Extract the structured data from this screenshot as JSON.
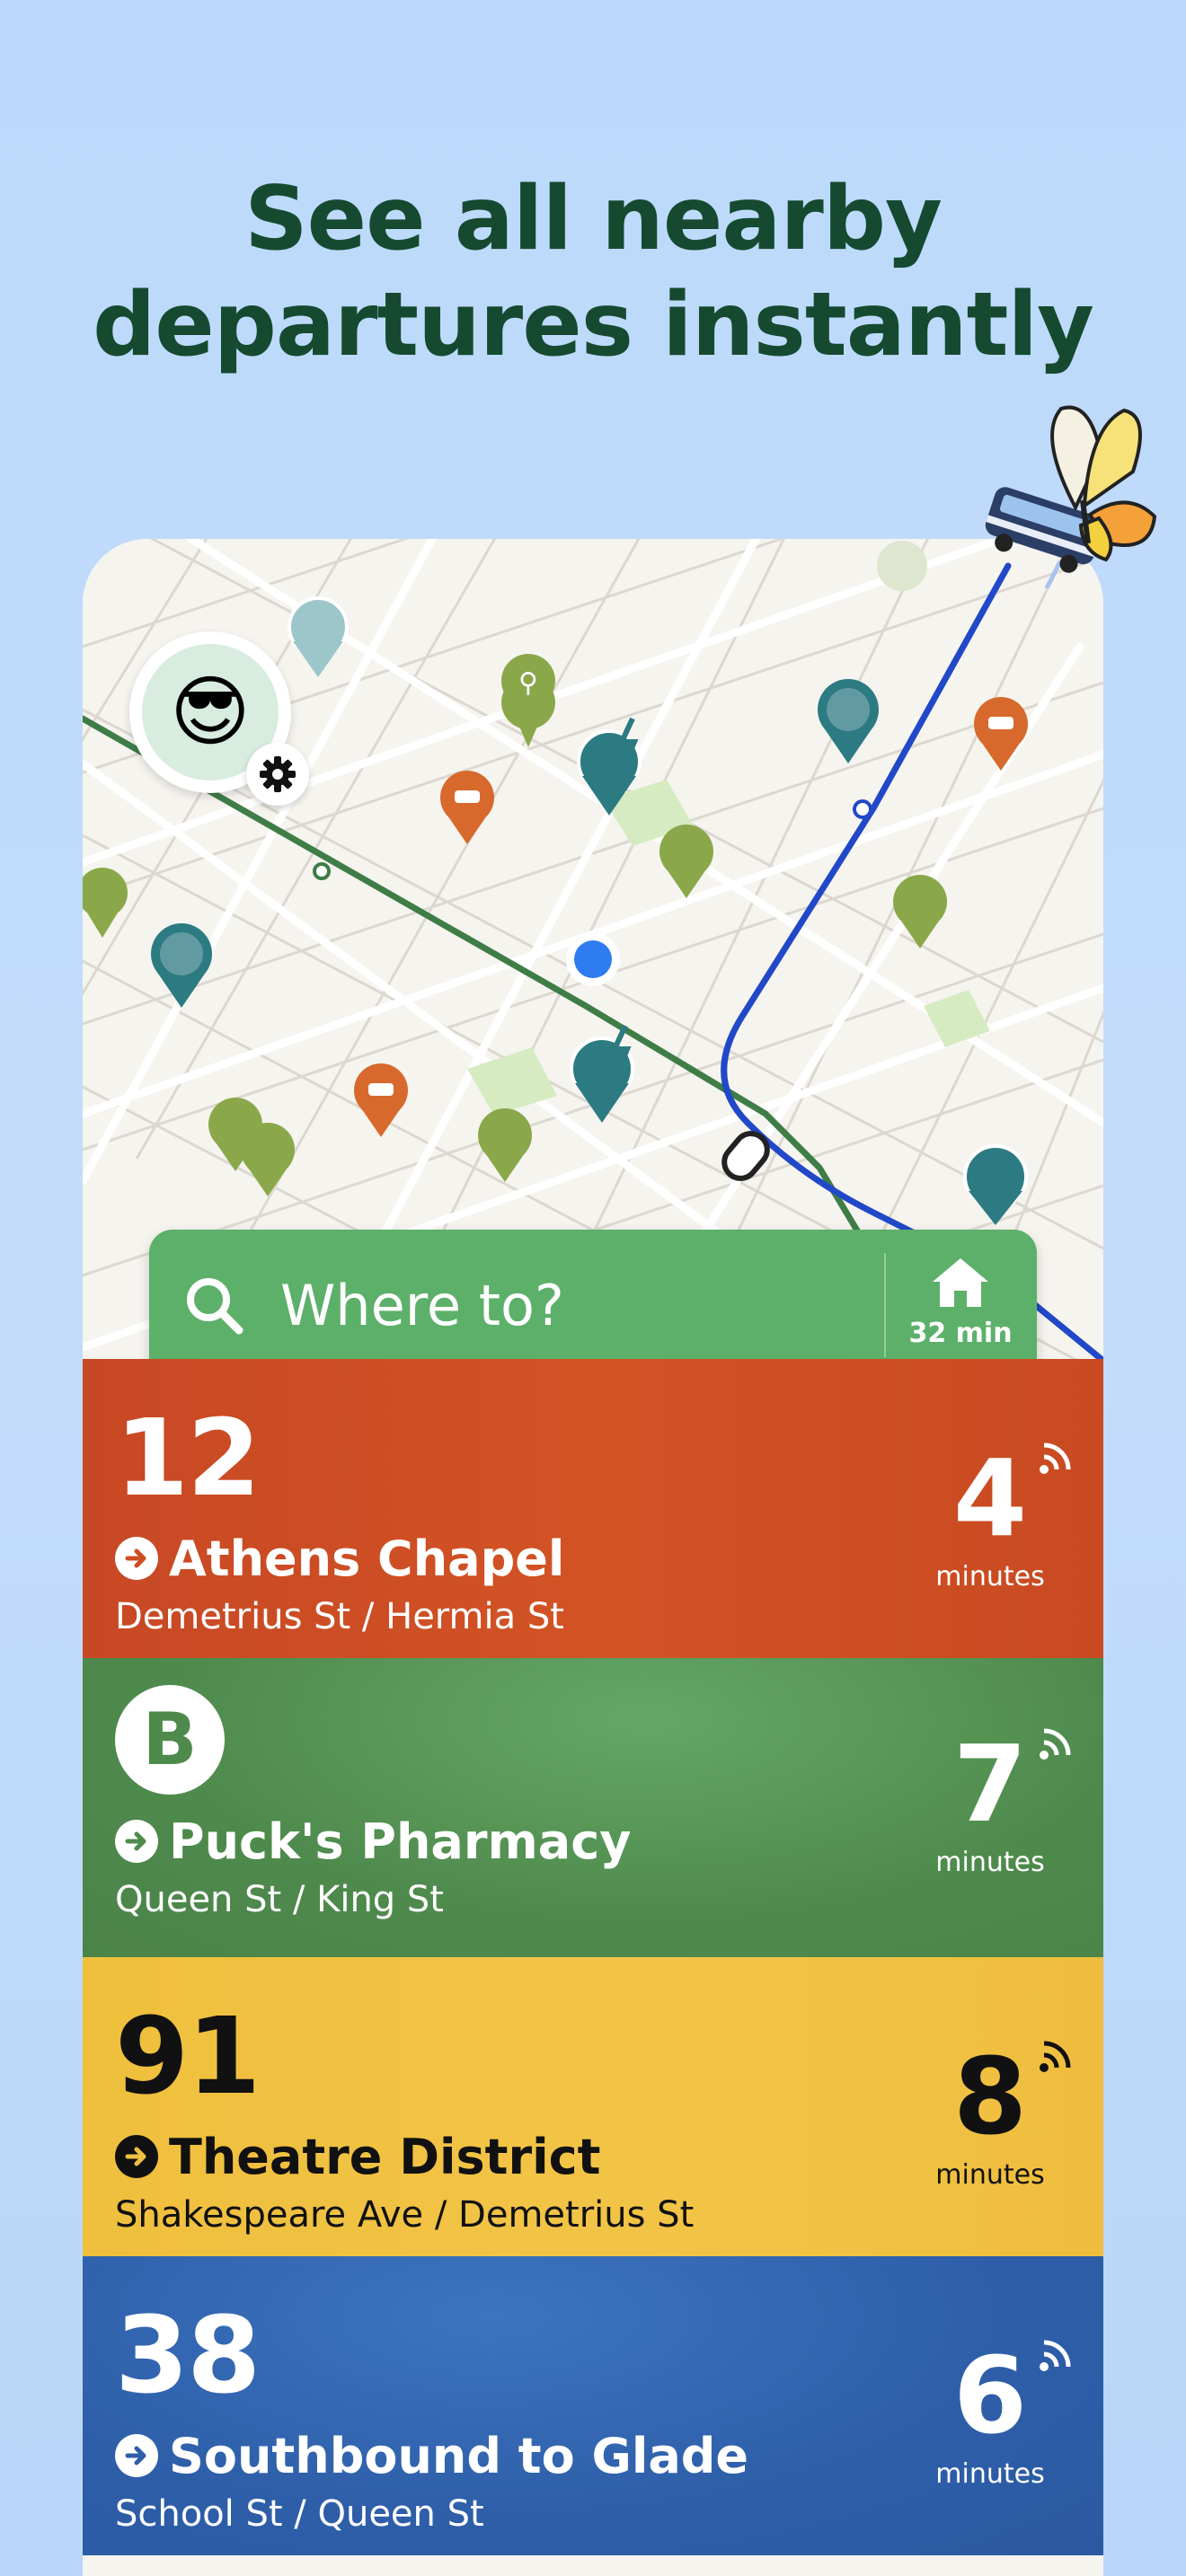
{
  "headline": {
    "line1": "See all nearby",
    "line2": "departures instantly"
  },
  "profile": {
    "emoji": "😎"
  },
  "search": {
    "placeholder": "Where to?",
    "home_time": "32 min"
  },
  "departures": [
    {
      "route": "12",
      "destination": "Athens Chapel",
      "stop": "Demetrius St / Hermia St",
      "minutes": "4",
      "unit": "minutes",
      "color": "#cc4d23"
    },
    {
      "route": "B",
      "destination": "Puck's Pharmacy",
      "stop": "Queen St / King St",
      "minutes": "7",
      "unit": "minutes",
      "color": "#4f8a4d"
    },
    {
      "route": "91",
      "destination": "Theatre District",
      "stop": "Shakespeare Ave / Demetrius St",
      "minutes": "8",
      "unit": "minutes",
      "color": "#f0c040"
    },
    {
      "route": "38",
      "destination": "Southbound to Glade",
      "stop": "School St / Queen St",
      "minutes": "6",
      "unit": "minutes",
      "color": "#2e5ea8"
    }
  ],
  "colors": {
    "map_green_pin": "#8aa84a",
    "map_teal_pin": "#2c7a82",
    "map_orange_pin": "#d8692c",
    "transit_line": "#2148c8",
    "route_line": "#3f7d47",
    "user_location": "#2f7bf0"
  }
}
